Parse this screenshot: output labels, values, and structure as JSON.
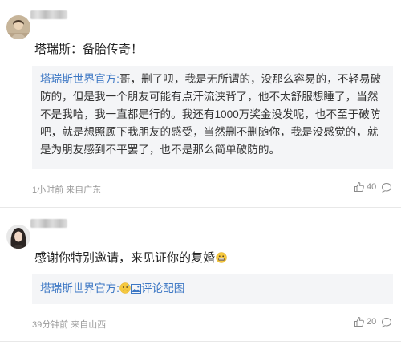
{
  "comments": [
    {
      "main_text": "塔瑞斯：备胎传奇！",
      "quote": {
        "author": "塔瑞斯世界官方:",
        "text": "哥，删了呗，我是无所谓的，没那么容易的，不轻易破防的，但是我一个朋友可能有点汗流浃背了，他不太舒服想睡了，当然不是我哈，我一直都是行的。我还有1000万奖金没发呢，也不至于破防吧，就是想照顾下我朋友的感受，当然删不删随你，我是没感觉的，就是为朋友感到不平罢了，也不是那么简单破防的。"
      },
      "meta": "1小时前 来自广东",
      "likes": "40",
      "avatar_icon": "avatar-icon",
      "like_icon": "thumbs-up-icon",
      "reply_icon": "reply-bubble-icon"
    },
    {
      "main_text": "感谢你特别邀请，来见证你的复婚",
      "quote": {
        "author": "塔瑞斯世界官方:",
        "image_link": "评论配图"
      },
      "meta": "39分钟前 来自山西",
      "likes": "20",
      "avatar_icon": "avatar-icon",
      "like_icon": "thumbs-up-icon",
      "reply_icon": "reply-bubble-icon"
    }
  ],
  "colors": {
    "link_blue": "#3c77c4",
    "quote_bg": "#f4f5f7",
    "meta_gray": "#999999",
    "divider": "#e8e8e8"
  }
}
